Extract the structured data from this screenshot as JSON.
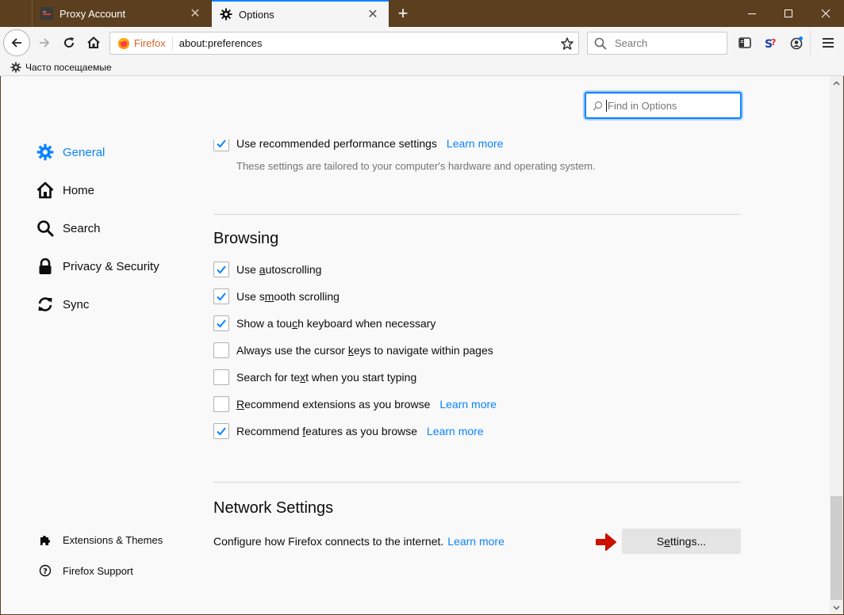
{
  "tabs": [
    {
      "title": "Proxy Account",
      "active": false,
      "favicon": "proxy-favicon-icon"
    },
    {
      "title": "Options",
      "active": true,
      "favicon": "gear-icon"
    }
  ],
  "window": {
    "new_tab": "+",
    "minimize": "minimize-icon",
    "maximize": "maximize-icon",
    "close": "close-icon"
  },
  "navbar": {
    "identity_label": "Firefox",
    "url": "about:preferences",
    "search_placeholder": "Search"
  },
  "bookmarks": {
    "item": "Часто посещаемые"
  },
  "find": {
    "placeholder": "Find in Options"
  },
  "sidebar": {
    "items": [
      {
        "label": "General",
        "icon": "gear-icon",
        "selected": true
      },
      {
        "label": "Home",
        "icon": "home-icon",
        "selected": false
      },
      {
        "label": "Search",
        "icon": "search-icon",
        "selected": false
      },
      {
        "label": "Privacy & Security",
        "icon": "lock-icon",
        "selected": false
      },
      {
        "label": "Sync",
        "icon": "sync-icon",
        "selected": false
      }
    ],
    "footer": [
      {
        "label": "Extensions & Themes",
        "icon": "puzzle-icon"
      },
      {
        "label": "Firefox Support",
        "icon": "help-icon"
      }
    ]
  },
  "performance": {
    "recommended": {
      "label": "Use recommended performance settings",
      "checked": true,
      "learn_more": "Learn more"
    },
    "description": "These settings are tailored to your computer's hardware and operating system."
  },
  "browsing": {
    "heading": "Browsing",
    "options": [
      {
        "pre": "Use ",
        "key": "a",
        "post": "utoscrolling",
        "checked": true
      },
      {
        "pre": "Use s",
        "key": "m",
        "post": "ooth scrolling",
        "checked": true
      },
      {
        "pre": "Show a tou",
        "key": "c",
        "post": "h keyboard when necessary",
        "checked": true
      },
      {
        "pre": "Always use the cursor ",
        "key": "k",
        "post": "eys to navigate within pages",
        "checked": false
      },
      {
        "pre": "Search for te",
        "key": "x",
        "post": "t when you start typing",
        "checked": false
      },
      {
        "pre": "",
        "key": "R",
        "post": "ecommend extensions as you browse",
        "checked": false,
        "learn_more": "Learn more"
      },
      {
        "pre": "Recommend ",
        "key": "f",
        "post": "eatures as you browse",
        "checked": true,
        "learn_more": "Learn more"
      }
    ]
  },
  "network": {
    "heading": "Network Settings",
    "description": "Configure how Firefox connects to the internet.",
    "learn_more": "Learn more",
    "button_pre": "S",
    "button_key": "e",
    "button_post": "ttings..."
  },
  "colors": {
    "accent": "#0a84ff",
    "titlebar": "#5b3f1f",
    "annotation_arrow": "#cc1100"
  }
}
